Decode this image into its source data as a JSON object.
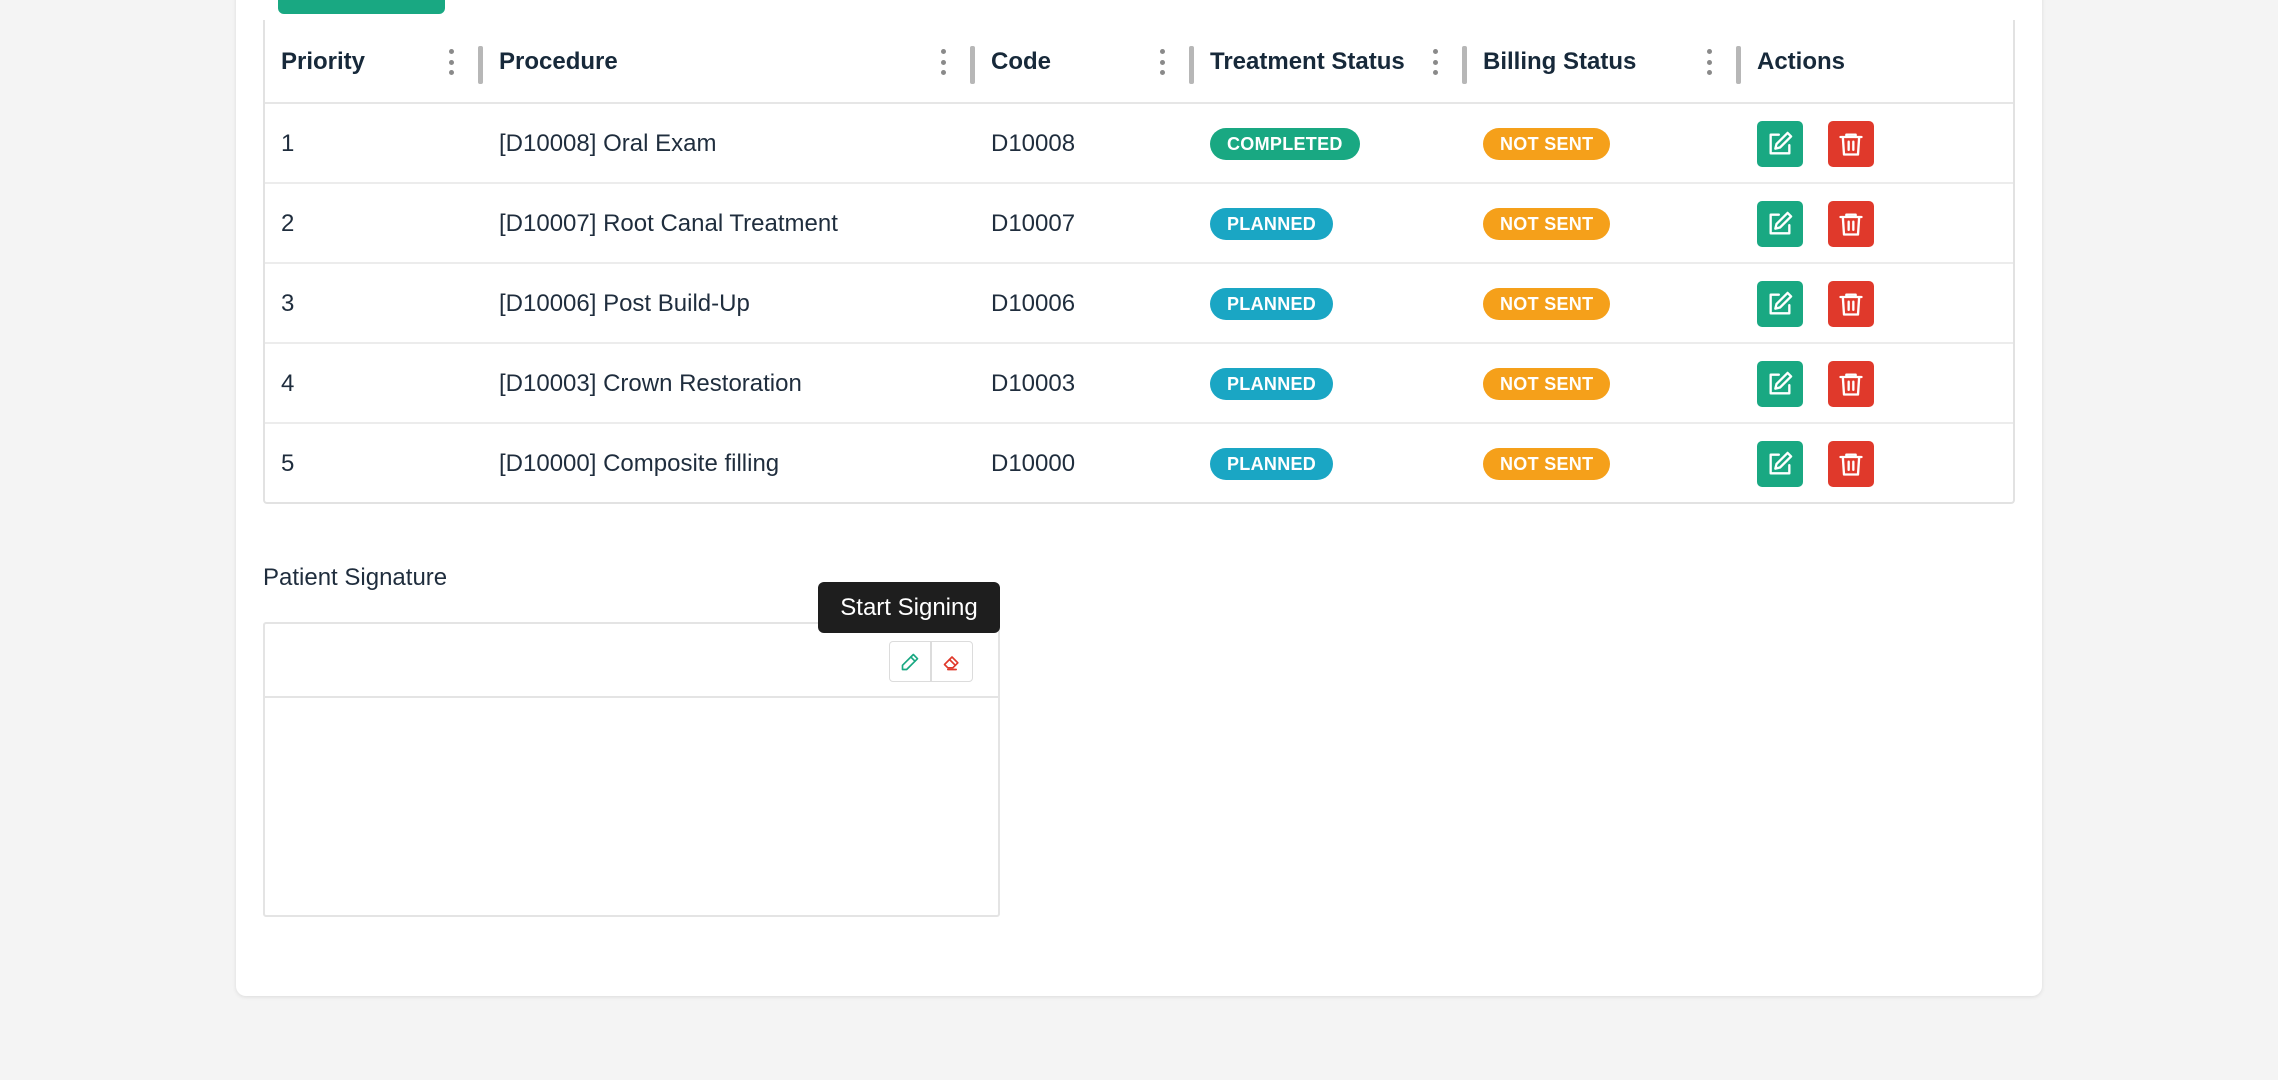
{
  "table": {
    "columns": [
      "Priority",
      "Procedure",
      "Code",
      "Treatment Status",
      "Billing Status",
      "Actions"
    ],
    "rows": [
      {
        "priority": "1",
        "procedure": "[D10008] Oral Exam",
        "code": "D10008",
        "treatment_status": "COMPLETED",
        "billing_status": "NOT SENT"
      },
      {
        "priority": "2",
        "procedure": "[D10007] Root Canal Treatment",
        "code": "D10007",
        "treatment_status": "PLANNED",
        "billing_status": "NOT SENT"
      },
      {
        "priority": "3",
        "procedure": "[D10006] Post Build-Up",
        "code": "D10006",
        "treatment_status": "PLANNED",
        "billing_status": "NOT SENT"
      },
      {
        "priority": "4",
        "procedure": "[D10003] Crown Restoration",
        "code": "D10003",
        "treatment_status": "PLANNED",
        "billing_status": "NOT SENT"
      },
      {
        "priority": "5",
        "procedure": "[D10000] Composite filling",
        "code": "D10000",
        "treatment_status": "PLANNED",
        "billing_status": "NOT SENT"
      }
    ]
  },
  "signature": {
    "title": "Patient Signature",
    "tooltip": "Start Signing"
  },
  "colors": {
    "brand_green": "#19a882",
    "completed": "#19a882",
    "planned": "#1aa6c4",
    "not_sent": "#f5a01a",
    "delete_red": "#e0392b"
  },
  "icons": {
    "edit": "edit-icon",
    "delete": "trash-icon",
    "pen": "pencil-icon",
    "eraser": "eraser-icon",
    "column_menu": "kebab-menu-icon"
  }
}
